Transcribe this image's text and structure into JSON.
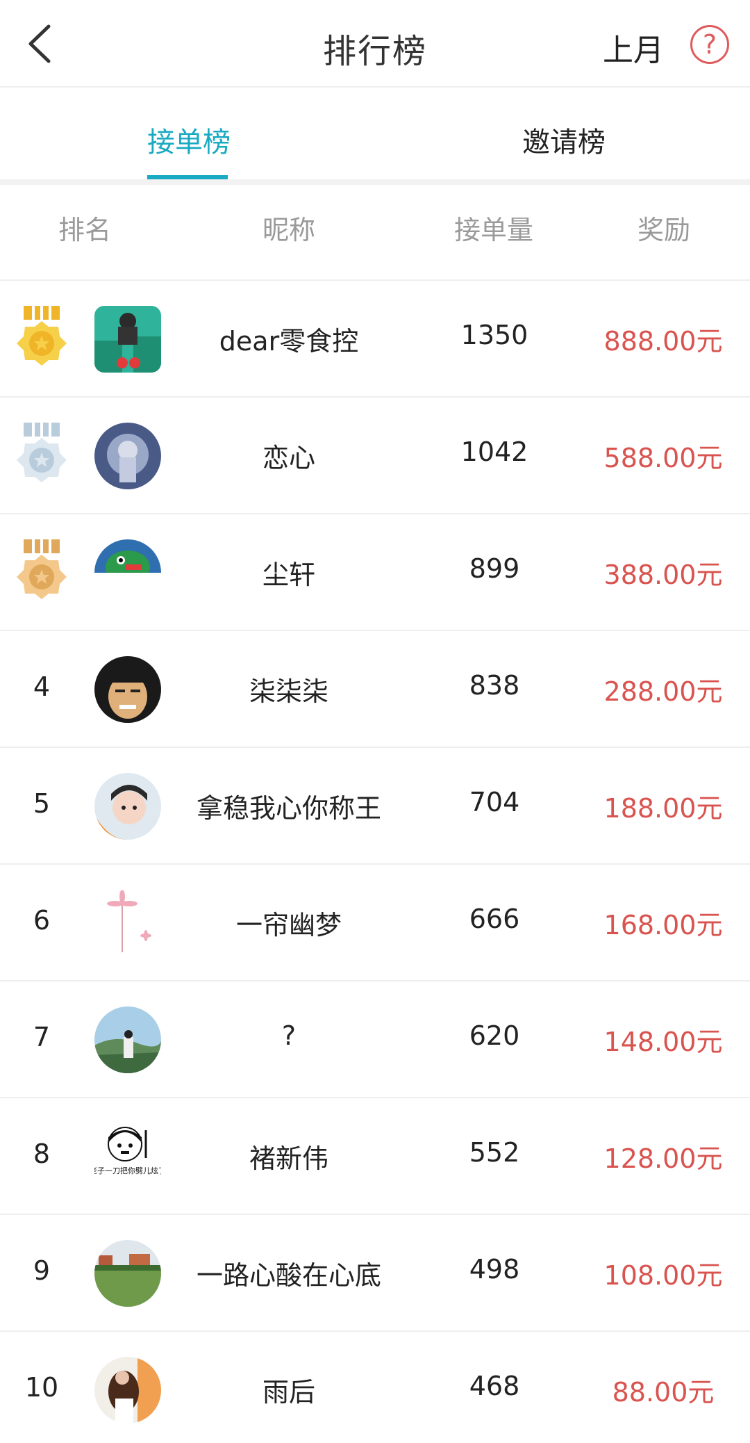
{
  "header": {
    "title": "排行榜",
    "period": "上月",
    "help_symbol": "?",
    "accent_color": "#e05a5a"
  },
  "tabs": [
    {
      "label": "接单榜",
      "active": true
    },
    {
      "label": "邀请榜",
      "active": false
    }
  ],
  "tab_active_color": "#1aa9c2",
  "columns": [
    "排名",
    "昵称",
    "接单量",
    "奖励"
  ],
  "reward_color": "#d9534f",
  "rows": [
    {
      "rank": "1",
      "medal": "gold",
      "avatar": "avatar-1-icon",
      "nickname": "dear零食控",
      "count": "1350",
      "reward": "888.00元"
    },
    {
      "rank": "2",
      "medal": "silver",
      "avatar": "avatar-2-icon",
      "nickname": "恋心",
      "count": "1042",
      "reward": "588.00元"
    },
    {
      "rank": "3",
      "medal": "bronze",
      "avatar": "avatar-3-icon",
      "nickname": "尘轩",
      "count": "899",
      "reward": "388.00元"
    },
    {
      "rank": "4",
      "medal": "",
      "avatar": "avatar-4-icon",
      "nickname": "柒柒柒",
      "count": "838",
      "reward": "288.00元"
    },
    {
      "rank": "5",
      "medal": "",
      "avatar": "avatar-5-icon",
      "nickname": "拿稳我心你称王",
      "count": "704",
      "reward": "188.00元"
    },
    {
      "rank": "6",
      "medal": "",
      "avatar": "avatar-6-icon",
      "nickname": "一帘幽梦",
      "count": "666",
      "reward": "168.00元"
    },
    {
      "rank": "7",
      "medal": "",
      "avatar": "avatar-7-icon",
      "nickname": "?",
      "count": "620",
      "reward": "148.00元"
    },
    {
      "rank": "8",
      "medal": "",
      "avatar": "avatar-8-icon",
      "avatar_caption": "老子一刀把你劈儿炫了",
      "nickname": "褚新伟",
      "count": "552",
      "reward": "128.00元"
    },
    {
      "rank": "9",
      "medal": "",
      "avatar": "avatar-9-icon",
      "nickname": "一路心酸在心底",
      "count": "498",
      "reward": "108.00元"
    },
    {
      "rank": "10",
      "medal": "",
      "avatar": "avatar-10-icon",
      "nickname": "雨后",
      "count": "468",
      "reward": "88.00元"
    }
  ]
}
